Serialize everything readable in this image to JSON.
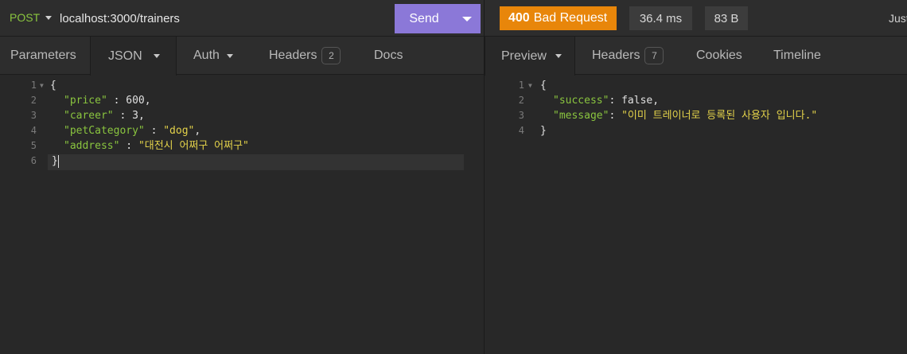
{
  "request": {
    "method": "POST",
    "url": "localhost:3000/trainers",
    "send_label": "Send",
    "tabs": [
      {
        "label": "Parameters"
      },
      {
        "label": "JSON"
      },
      {
        "label": "Auth"
      },
      {
        "label": "Headers",
        "badge": "2"
      },
      {
        "label": "Docs"
      }
    ],
    "body_lines": [
      {
        "num": "1",
        "fold": true
      },
      {
        "num": "2"
      },
      {
        "num": "3"
      },
      {
        "num": "4"
      },
      {
        "num": "5"
      },
      {
        "num": "6"
      }
    ],
    "body": {
      "open": "{",
      "close": "}",
      "fields": [
        {
          "key": "\"price\"",
          "sep": " : ",
          "value": "600",
          "trail": ","
        },
        {
          "key": "\"career\"",
          "sep": " : ",
          "value": "3",
          "trail": ","
        },
        {
          "key": "\"petCategory\"",
          "sep": " : ",
          "value": "\"dog\"",
          "trail": ","
        },
        {
          "key": "\"address\"",
          "sep": " : ",
          "value": "\"대전시 어쩌구 어쩌구\"",
          "trail": ""
        }
      ]
    }
  },
  "response": {
    "status_code": "400",
    "status_text": "Bad Request",
    "time": "36.4 ms",
    "size": "83 B",
    "timestamp": "Just Now",
    "tabs": [
      {
        "label": "Preview"
      },
      {
        "label": "Headers",
        "badge": "7"
      },
      {
        "label": "Cookies"
      },
      {
        "label": "Timeline"
      }
    ],
    "body_lines": [
      {
        "num": "1",
        "fold": true
      },
      {
        "num": "2"
      },
      {
        "num": "3"
      },
      {
        "num": "4"
      }
    ],
    "body": {
      "open": "{",
      "close": "}",
      "fields": [
        {
          "key": "\"success\"",
          "sep": ": ",
          "value": "false",
          "trail": ","
        },
        {
          "key": "\"message\"",
          "sep": ": ",
          "value": "\"이미 트레이너로 등록된 사용자 입니다.\"",
          "trail": ""
        }
      ]
    }
  },
  "colors": {
    "method": "#8ac53f",
    "send_button": "#8b78d8",
    "status_badge": "#e8860a",
    "json_key": "#8ac53f",
    "json_string": "#e3d24a"
  },
  "icons": {
    "method_dropdown": "caret-down-icon",
    "send_dropdown": "caret-down-icon",
    "fold": "fold-arrow-icon"
  }
}
